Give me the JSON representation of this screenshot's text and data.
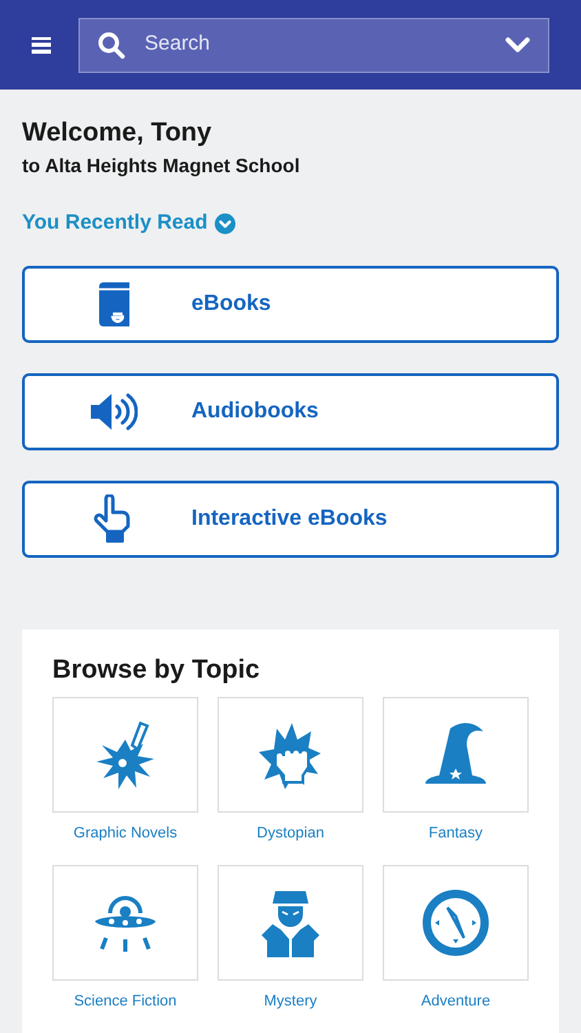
{
  "header": {
    "search": {
      "placeholder": "Search"
    }
  },
  "welcome": {
    "title": "Welcome, Tony",
    "subtitle": "to Alta Heights Magnet School"
  },
  "recently_read": {
    "label": "You Recently Read",
    "expanded": false
  },
  "formats": [
    {
      "label": "eBooks"
    },
    {
      "label": "Audiobooks"
    },
    {
      "label": "Interactive eBooks"
    }
  ],
  "browse": {
    "title": "Browse by Topic",
    "topics": [
      {
        "label": "Graphic Novels"
      },
      {
        "label": "Dystopian"
      },
      {
        "label": "Fantasy"
      },
      {
        "label": "Science Fiction"
      },
      {
        "label": "Mystery"
      },
      {
        "label": "Adventure"
      }
    ]
  }
}
